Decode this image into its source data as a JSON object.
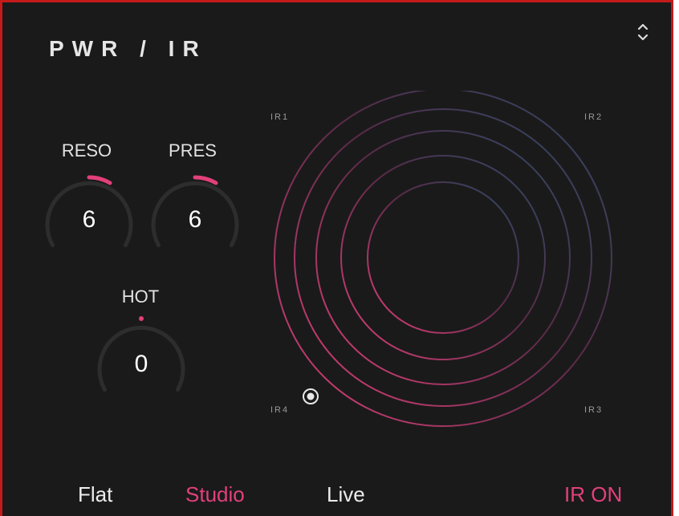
{
  "title": "PWR / IR",
  "colors": {
    "accent": "#e2407a",
    "background": "#1a1a1a",
    "border": "#c41a1a"
  },
  "knobs": {
    "reso": {
      "label": "RESO",
      "value": "6"
    },
    "pres": {
      "label": "PRES",
      "value": "6"
    },
    "hot": {
      "label": "HOT",
      "value": "0"
    }
  },
  "ir_pad": {
    "corners": {
      "tl": "IR1",
      "tr": "IR2",
      "br": "IR3",
      "bl": "IR4"
    }
  },
  "modes": {
    "flat": "Flat",
    "studio": "Studio",
    "live": "Live",
    "selected": "Studio"
  },
  "ir_toggle": "IR ON",
  "icons": {
    "collapse": "chevron-up-down-icon",
    "pad_handle": "target-icon"
  }
}
